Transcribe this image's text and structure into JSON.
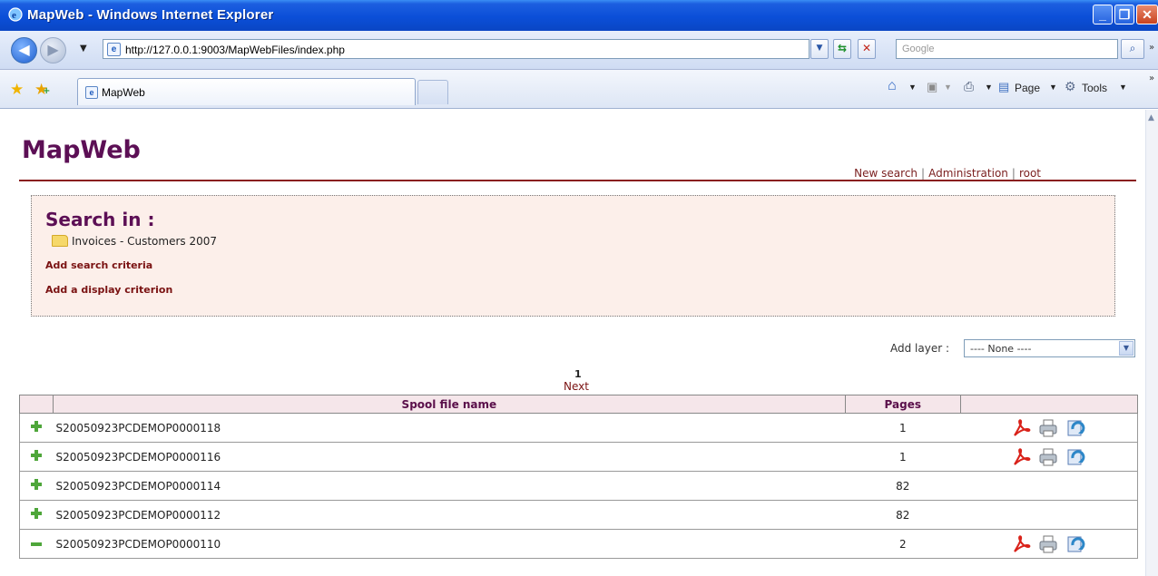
{
  "window": {
    "title": "MapWeb - Windows Internet Explorer"
  },
  "browser": {
    "url": "http://127.0.0.1:9003/MapWebFiles/index.php",
    "search_placeholder": "Google",
    "tab_title": "MapWeb",
    "page_menu": "Page",
    "tools_menu": "Tools"
  },
  "app": {
    "title": "MapWeb",
    "links": {
      "new_search": "New search",
      "administration": "Administration",
      "root": "root"
    }
  },
  "search": {
    "heading": "Search in :",
    "folder": "Invoices - Customers 2007",
    "add_search_criteria": "Add search criteria",
    "add_display_criterion": "Add a display criterion"
  },
  "layer": {
    "label": "Add layer :",
    "selected": "---- None ----"
  },
  "pager": {
    "current": "1",
    "next": "Next"
  },
  "table": {
    "headers": {
      "name": "Spool file name",
      "pages": "Pages"
    },
    "rows": [
      {
        "name": "S20050923PCDEMOP0000118",
        "pages": "1",
        "expanded": false,
        "actions": [
          "pdf-icon",
          "printer-icon",
          "export-icon"
        ]
      },
      {
        "name": "S20050923PCDEMOP0000116",
        "pages": "1",
        "expanded": false,
        "actions": [
          "pdf-icon",
          "printer-icon",
          "export-icon"
        ]
      },
      {
        "name": "S20050923PCDEMOP0000114",
        "pages": "82",
        "expanded": false,
        "actions": []
      },
      {
        "name": "S20050923PCDEMOP0000112",
        "pages": "82",
        "expanded": false,
        "actions": []
      },
      {
        "name": "S20050923PCDEMOP0000110",
        "pages": "2",
        "expanded": true,
        "actions": [
          "pdf-icon",
          "printer-icon",
          "export-icon"
        ]
      }
    ]
  },
  "colors": {
    "brand": "#5c0f55",
    "link": "#7a1212",
    "rule": "#8a1f1f",
    "panel_bg": "#fcefea",
    "header_bg": "#f5e6ea"
  }
}
